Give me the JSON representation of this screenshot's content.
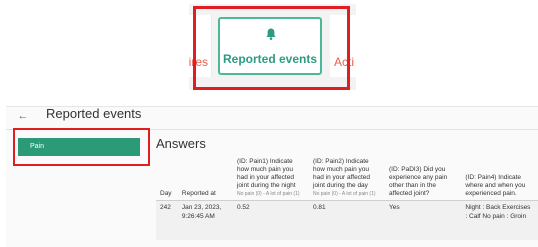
{
  "tabs": {
    "left_partial_label": "aires",
    "active_label": "Reported events",
    "right_partial_label": "Acti",
    "active_icon": "bell-icon"
  },
  "page": {
    "back_icon": "arrow-left-icon",
    "title": "Reported events"
  },
  "sidebar": {
    "items": [
      {
        "label": "Pain"
      }
    ]
  },
  "answers": {
    "title": "Answers",
    "columns": [
      {
        "header": "Day",
        "hint": ""
      },
      {
        "header": "Reported at",
        "hint": ""
      },
      {
        "header": "(ID: Pain1) Indicate how much pain you had in your affected joint during the night",
        "hint": "No pain (0) - A lot of pain (1)"
      },
      {
        "header": "(ID: Pain2) Indicate how much pain you had in your affected joint during the day",
        "hint": "No pain (0) - A lot of pain (1)"
      },
      {
        "header": "(ID: PaDI3) Did you experience any pain other than in the affected joint?",
        "hint": ""
      },
      {
        "header": "(ID: Pain4) Indicate where and when you experienced pain.",
        "hint": ""
      }
    ],
    "rows": [
      {
        "day": "242",
        "reported_at": "Jan 23, 2023, 9:26:45 AM",
        "pain1": "0.52",
        "pain2": "0.81",
        "padi3": "Yes",
        "pain4": "Night : Back Exercises : Calf No pain : Groin"
      }
    ]
  },
  "colors": {
    "accent": "#2b9a76",
    "active_tab_border": "#4bb89a",
    "highlight": "#e01e22",
    "inactive_tab_text": "#e8604c"
  }
}
